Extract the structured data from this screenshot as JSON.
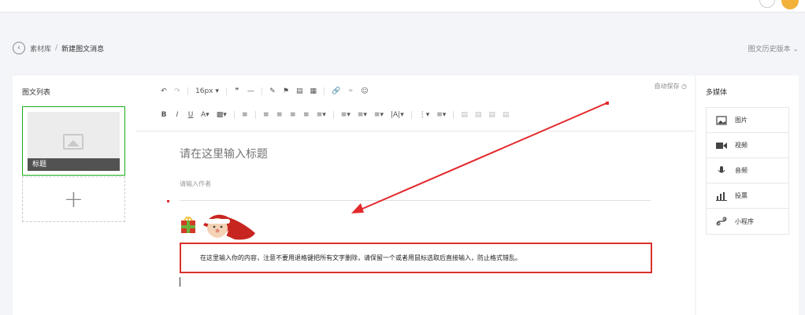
{
  "breadcrumb": {
    "parent": "素材库",
    "separator": "/",
    "current": "新建图文消息"
  },
  "history_link": "图文历史版本",
  "left_panel": {
    "title": "图文列表",
    "article_thumb_title": "标题",
    "add_symbol": "+"
  },
  "toolbar": {
    "font_size": "16px",
    "autosave": "自动保存"
  },
  "editor": {
    "title_placeholder": "请在这里输入标题",
    "author_placeholder": "请输入作者",
    "content_text": "在这里输入你的内容，注意不要用退格键把所有文字删除，请保留一个或者用鼠标选取后直接输入，防止格式错乱。"
  },
  "right_panel": {
    "title": "多媒体",
    "items": [
      {
        "label": "图片",
        "icon": "image-icon"
      },
      {
        "label": "视频",
        "icon": "video-icon"
      },
      {
        "label": "音频",
        "icon": "microphone-icon"
      },
      {
        "label": "投票",
        "icon": "vote-icon"
      },
      {
        "label": "小程序",
        "icon": "miniprogram-icon"
      }
    ]
  },
  "colors": {
    "accent_green": "#1aad19",
    "annotation_red": "#d9312c"
  }
}
